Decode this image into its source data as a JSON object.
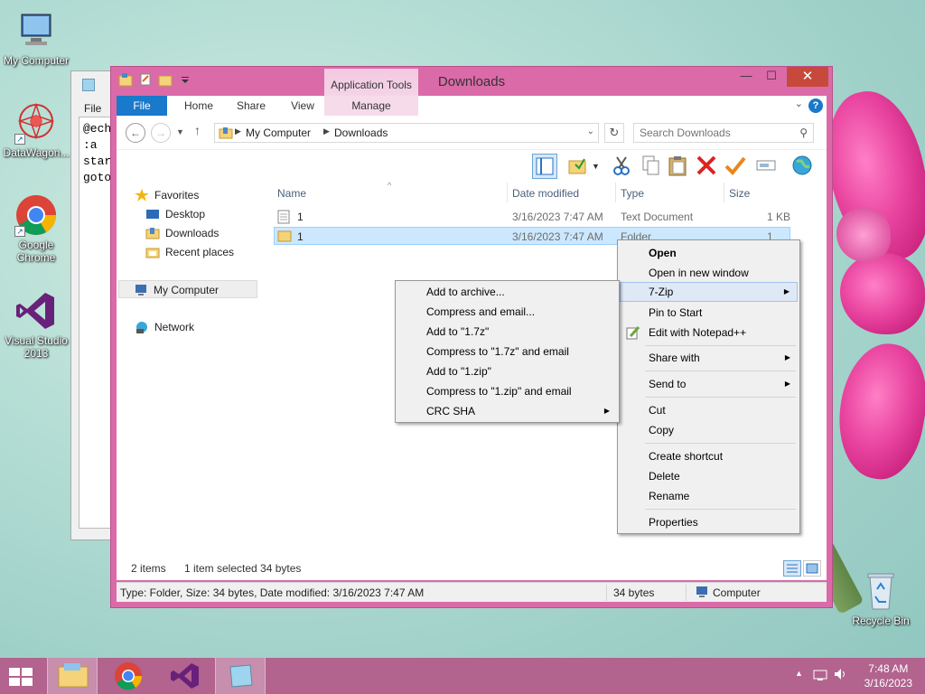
{
  "desktop": {
    "icons": [
      {
        "label": "My Computer"
      },
      {
        "label": "DataWagon..."
      },
      {
        "label": "Google Chrome"
      },
      {
        "label": "Visual Studio 2013"
      },
      {
        "label": "Recycle Bin"
      }
    ]
  },
  "notepad": {
    "menu_label": "File",
    "lines": [
      "@ech",
      ":a",
      "star",
      "goto"
    ]
  },
  "explorer": {
    "title": "Downloads",
    "context_tab_group": "Application Tools",
    "ribbon_tabs": [
      "File",
      "Home",
      "Share",
      "View",
      "Manage"
    ],
    "help_icon": "?",
    "address": {
      "crumbs": [
        "My Computer",
        "Downloads"
      ]
    },
    "search": {
      "placeholder": "Search Downloads"
    },
    "nav_pane": {
      "favorites_label": "Favorites",
      "favorites": [
        "Desktop",
        "Downloads",
        "Recent places"
      ],
      "computer_label": "My Computer",
      "network_label": "Network"
    },
    "columns": {
      "name": "Name",
      "date": "Date modified",
      "type": "Type",
      "size": "Size"
    },
    "files": [
      {
        "name": "1",
        "date": "3/16/2023 7:47 AM",
        "type": "Text Document",
        "size": "1 KB",
        "selected": false
      },
      {
        "name": "1",
        "date": "3/16/2023 7:47 AM",
        "type": "Folder",
        "size": "1 KB",
        "selected": true
      }
    ],
    "status": {
      "items": "2 items",
      "selection": "1 item selected  34 bytes"
    },
    "details_bar": {
      "info": "Type: Folder, Size: 34 bytes, Date modified: 3/16/2023 7:47 AM",
      "size": "34 bytes",
      "location": "Computer"
    }
  },
  "context_menu": {
    "items": {
      "open": "Open",
      "open_new_window": "Open in new window",
      "seven_zip": "7-Zip",
      "pin_start": "Pin to Start",
      "edit_notepad": "Edit with Notepad++",
      "share_with": "Share with",
      "send_to": "Send to",
      "cut": "Cut",
      "copy": "Copy",
      "create_shortcut": "Create shortcut",
      "delete": "Delete",
      "rename": "Rename",
      "properties": "Properties"
    }
  },
  "submenu_7zip": {
    "items": [
      "Add to archive...",
      "Compress and email...",
      "Add to \"1.7z\"",
      "Compress to \"1.7z\" and email",
      "Add to \"1.zip\"",
      "Compress to \"1.zip\" and email",
      "CRC SHA"
    ]
  },
  "taskbar": {
    "time": "7:48 AM",
    "date": "3/16/2023"
  },
  "colors": {
    "window_frame": "#db6aa9",
    "taskbar": "#b2638e",
    "file_tab": "#1979ca",
    "selection": "#cce8ff"
  }
}
